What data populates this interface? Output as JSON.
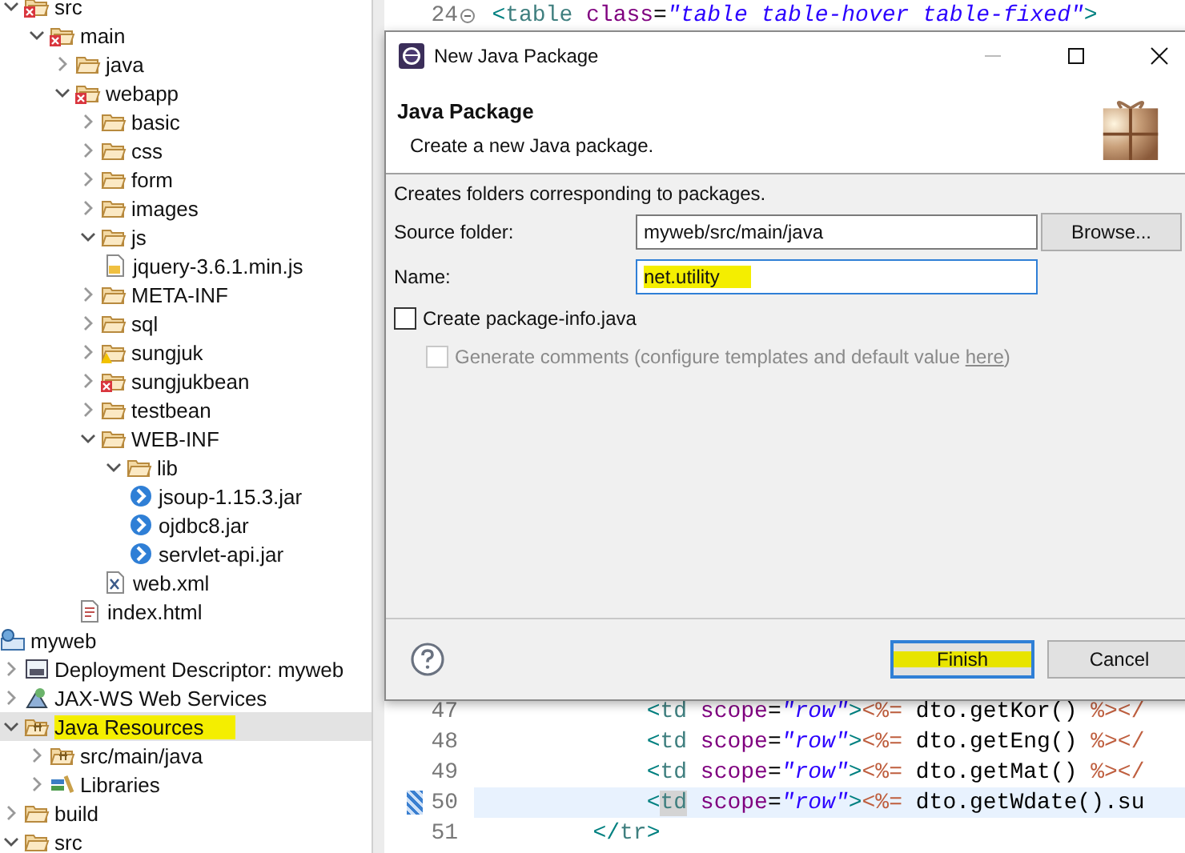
{
  "explorer": {
    "items": [
      {
        "label": "src",
        "kind": "folder",
        "error": true,
        "expanded": true,
        "selected": false,
        "highlighted": false,
        "children": [
          {
            "label": "main",
            "kind": "folder",
            "error": true,
            "expanded": true,
            "selected": false,
            "highlighted": false,
            "children": [
              {
                "label": "java",
                "kind": "folder",
                "expanded": false,
                "selected": false,
                "highlighted": false
              },
              {
                "label": "webapp",
                "kind": "folder",
                "error": true,
                "expanded": true,
                "selected": false,
                "highlighted": false,
                "children": [
                  {
                    "label": "basic",
                    "kind": "folder",
                    "expanded": false,
                    "selected": false,
                    "highlighted": false
                  },
                  {
                    "label": "css",
                    "kind": "folder",
                    "expanded": false,
                    "selected": false,
                    "highlighted": false
                  },
                  {
                    "label": "form",
                    "kind": "folder",
                    "expanded": false,
                    "selected": false,
                    "highlighted": false
                  },
                  {
                    "label": "images",
                    "kind": "folder",
                    "expanded": false,
                    "selected": false,
                    "highlighted": false
                  },
                  {
                    "label": "js",
                    "kind": "folder",
                    "expanded": true,
                    "selected": false,
                    "highlighted": false,
                    "children": [
                      {
                        "label": "jquery-3.6.1.min.js",
                        "kind": "js-file",
                        "selected": false,
                        "highlighted": false
                      }
                    ]
                  },
                  {
                    "label": "META-INF",
                    "kind": "folder",
                    "expanded": false,
                    "selected": false,
                    "highlighted": false
                  },
                  {
                    "label": "sql",
                    "kind": "folder",
                    "expanded": false,
                    "selected": false,
                    "highlighted": false
                  },
                  {
                    "label": "sungjuk",
                    "kind": "folder",
                    "warning": true,
                    "expanded": false,
                    "selected": false,
                    "highlighted": false
                  },
                  {
                    "label": "sungjukbean",
                    "kind": "folder",
                    "error": true,
                    "expanded": false,
                    "selected": false,
                    "highlighted": false
                  },
                  {
                    "label": "testbean",
                    "kind": "folder",
                    "expanded": false,
                    "selected": false,
                    "highlighted": false
                  },
                  {
                    "label": "WEB-INF",
                    "kind": "folder",
                    "expanded": true,
                    "selected": false,
                    "highlighted": false,
                    "children": [
                      {
                        "label": "lib",
                        "kind": "folder",
                        "expanded": true,
                        "selected": false,
                        "highlighted": false,
                        "children": [
                          {
                            "label": "jsoup-1.15.3.jar",
                            "kind": "jar",
                            "selected": false,
                            "highlighted": false
                          },
                          {
                            "label": "ojdbc8.jar",
                            "kind": "jar",
                            "selected": false,
                            "highlighted": false
                          },
                          {
                            "label": "servlet-api.jar",
                            "kind": "jar",
                            "selected": false,
                            "highlighted": false
                          }
                        ]
                      },
                      {
                        "label": "web.xml",
                        "kind": "xml-file",
                        "selected": false,
                        "highlighted": false
                      }
                    ]
                  },
                  {
                    "label": "index.html",
                    "kind": "html-file",
                    "selected": false,
                    "highlighted": false
                  }
                ]
              }
            ]
          }
        ]
      },
      {
        "label": "myweb",
        "kind": "project",
        "selected": false,
        "highlighted": false,
        "children": [
          {
            "label": "Deployment Descriptor: myweb",
            "kind": "descriptor",
            "expanded": false,
            "selected": false,
            "highlighted": false
          },
          {
            "label": "JAX-WS Web Services",
            "kind": "web-services",
            "expanded": false,
            "selected": false,
            "highlighted": false
          },
          {
            "label": "Java Resources",
            "kind": "java-resources",
            "expanded": true,
            "selected": true,
            "highlighted": true,
            "children": [
              {
                "label": "src/main/java",
                "kind": "package-root",
                "expanded": false,
                "selected": false,
                "highlighted": false
              },
              {
                "label": "Libraries",
                "kind": "libraries",
                "expanded": false,
                "selected": false,
                "highlighted": false
              }
            ]
          },
          {
            "label": "build",
            "kind": "folder",
            "expanded": false,
            "selected": false,
            "highlighted": false
          },
          {
            "label": "src",
            "kind": "folder",
            "expanded": true,
            "selected": false,
            "highlighted": false
          }
        ]
      }
    ]
  },
  "editor": {
    "lines_above": [
      {
        "number": "24",
        "kind": "table",
        "folded": true,
        "current": false,
        "tokens": [
          {
            "kind": "bracket",
            "text": "<"
          },
          {
            "kind": "tag",
            "text": "table"
          },
          {
            "kind": "attr",
            "text": " class"
          },
          {
            "kind": "plain",
            "text": "="
          },
          {
            "kind": "string",
            "text": "\"table table-hover table-fixed\""
          },
          {
            "kind": "bracket",
            "text": ">"
          }
        ]
      }
    ],
    "lines_below": [
      {
        "number": "47",
        "kind": "cell",
        "folded": false,
        "current": false,
        "tokens": [
          {
            "kind": "bracket",
            "text": "<"
          },
          {
            "kind": "tag",
            "text": "td"
          },
          {
            "kind": "attr",
            "text": " scope"
          },
          {
            "kind": "plain",
            "text": "="
          },
          {
            "kind": "string",
            "text": "\"row\""
          },
          {
            "kind": "bracket",
            "text": ">"
          },
          {
            "kind": "jsp",
            "text": "<%="
          },
          {
            "kind": "plain",
            "text": " dto.getKor() "
          },
          {
            "kind": "jsp",
            "text": "%></"
          }
        ]
      },
      {
        "number": "48",
        "kind": "cell",
        "folded": false,
        "current": false,
        "tokens": [
          {
            "kind": "bracket",
            "text": "<"
          },
          {
            "kind": "tag",
            "text": "td"
          },
          {
            "kind": "attr",
            "text": " scope"
          },
          {
            "kind": "plain",
            "text": "="
          },
          {
            "kind": "string",
            "text": "\"row\""
          },
          {
            "kind": "bracket",
            "text": ">"
          },
          {
            "kind": "jsp",
            "text": "<%="
          },
          {
            "kind": "plain",
            "text": " dto.getEng() "
          },
          {
            "kind": "jsp",
            "text": "%></"
          }
        ]
      },
      {
        "number": "49",
        "kind": "cell",
        "folded": false,
        "current": false,
        "tokens": [
          {
            "kind": "bracket",
            "text": "<"
          },
          {
            "kind": "tag",
            "text": "td"
          },
          {
            "kind": "attr",
            "text": " scope"
          },
          {
            "kind": "plain",
            "text": "="
          },
          {
            "kind": "string",
            "text": "\"row\""
          },
          {
            "kind": "bracket",
            "text": ">"
          },
          {
            "kind": "jsp",
            "text": "<%="
          },
          {
            "kind": "plain",
            "text": " dto.getMat() "
          },
          {
            "kind": "jsp",
            "text": "%></"
          }
        ]
      },
      {
        "number": "50",
        "kind": "cell",
        "folded": false,
        "current": true,
        "tokens": [
          {
            "kind": "bracket",
            "text": "<"
          },
          {
            "kind": "tag-occurrence",
            "text": "td"
          },
          {
            "kind": "attr",
            "text": " scope"
          },
          {
            "kind": "plain",
            "text": "="
          },
          {
            "kind": "string",
            "text": "\"row\""
          },
          {
            "kind": "bracket",
            "text": ">"
          },
          {
            "kind": "jsp",
            "text": "<%="
          },
          {
            "kind": "plain",
            "text": " dto.getWdate().su"
          }
        ]
      },
      {
        "number": "51",
        "kind": "row-end",
        "folded": false,
        "current": false,
        "tokens": [
          {
            "kind": "bracket",
            "text": "</"
          },
          {
            "kind": "tag",
            "text": "tr"
          },
          {
            "kind": "bracket",
            "text": ">"
          }
        ]
      }
    ]
  },
  "dialog": {
    "title": "New Java Package",
    "heading": "Java Package",
    "description": "Create a new Java package.",
    "message": "Creates folders corresponding to packages.",
    "fields": [
      {
        "label": "Source folder:",
        "value": "myweb/src/main/java",
        "focused": false,
        "highlighted": false,
        "button": "Browse..."
      },
      {
        "label": "Name:",
        "value": "net.utility",
        "focused": true,
        "highlighted": true
      }
    ],
    "checkboxes": [
      {
        "label": "Create package-info.java",
        "checked": false,
        "disabled": false
      },
      {
        "label": "Generate comments (configure templates and default value ",
        "link": "here",
        "label_end": ")",
        "checked": false,
        "disabled": true
      }
    ],
    "buttons": [
      {
        "label": "Finish",
        "default": true,
        "highlighted": true
      },
      {
        "label": "Cancel",
        "default": false,
        "highlighted": false
      }
    ]
  }
}
